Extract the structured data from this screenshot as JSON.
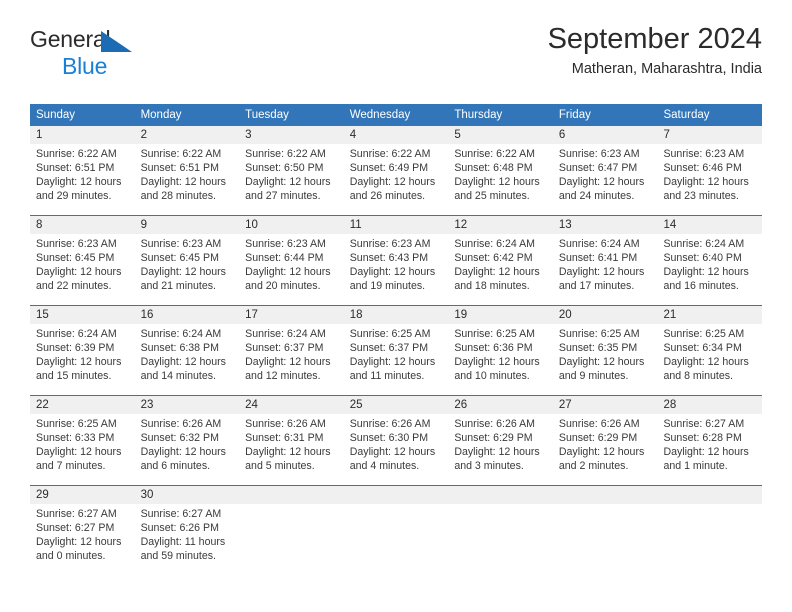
{
  "brand": {
    "name_part1": "General",
    "name_part2": "Blue",
    "triangle_color": "#1b6cb5",
    "blue_text_color": "#1b80d4"
  },
  "header": {
    "title": "September 2024",
    "subtitle": "Matheran, Maharashtra, India"
  },
  "theme": {
    "header_blue": "#3275b8",
    "day_band_gray": "#f0f0f0",
    "text_color": "#2b2b2b"
  },
  "weekdays": [
    "Sunday",
    "Monday",
    "Tuesday",
    "Wednesday",
    "Thursday",
    "Friday",
    "Saturday"
  ],
  "weeks": [
    {
      "days": [
        {
          "num": "1",
          "sunrise": "Sunrise: 6:22 AM",
          "sunset": "Sunset: 6:51 PM",
          "daylight1": "Daylight: 12 hours",
          "daylight2": "and 29 minutes."
        },
        {
          "num": "2",
          "sunrise": "Sunrise: 6:22 AM",
          "sunset": "Sunset: 6:51 PM",
          "daylight1": "Daylight: 12 hours",
          "daylight2": "and 28 minutes."
        },
        {
          "num": "3",
          "sunrise": "Sunrise: 6:22 AM",
          "sunset": "Sunset: 6:50 PM",
          "daylight1": "Daylight: 12 hours",
          "daylight2": "and 27 minutes."
        },
        {
          "num": "4",
          "sunrise": "Sunrise: 6:22 AM",
          "sunset": "Sunset: 6:49 PM",
          "daylight1": "Daylight: 12 hours",
          "daylight2": "and 26 minutes."
        },
        {
          "num": "5",
          "sunrise": "Sunrise: 6:22 AM",
          "sunset": "Sunset: 6:48 PM",
          "daylight1": "Daylight: 12 hours",
          "daylight2": "and 25 minutes."
        },
        {
          "num": "6",
          "sunrise": "Sunrise: 6:23 AM",
          "sunset": "Sunset: 6:47 PM",
          "daylight1": "Daylight: 12 hours",
          "daylight2": "and 24 minutes."
        },
        {
          "num": "7",
          "sunrise": "Sunrise: 6:23 AM",
          "sunset": "Sunset: 6:46 PM",
          "daylight1": "Daylight: 12 hours",
          "daylight2": "and 23 minutes."
        }
      ]
    },
    {
      "days": [
        {
          "num": "8",
          "sunrise": "Sunrise: 6:23 AM",
          "sunset": "Sunset: 6:45 PM",
          "daylight1": "Daylight: 12 hours",
          "daylight2": "and 22 minutes."
        },
        {
          "num": "9",
          "sunrise": "Sunrise: 6:23 AM",
          "sunset": "Sunset: 6:45 PM",
          "daylight1": "Daylight: 12 hours",
          "daylight2": "and 21 minutes."
        },
        {
          "num": "10",
          "sunrise": "Sunrise: 6:23 AM",
          "sunset": "Sunset: 6:44 PM",
          "daylight1": "Daylight: 12 hours",
          "daylight2": "and 20 minutes."
        },
        {
          "num": "11",
          "sunrise": "Sunrise: 6:23 AM",
          "sunset": "Sunset: 6:43 PM",
          "daylight1": "Daylight: 12 hours",
          "daylight2": "and 19 minutes."
        },
        {
          "num": "12",
          "sunrise": "Sunrise: 6:24 AM",
          "sunset": "Sunset: 6:42 PM",
          "daylight1": "Daylight: 12 hours",
          "daylight2": "and 18 minutes."
        },
        {
          "num": "13",
          "sunrise": "Sunrise: 6:24 AM",
          "sunset": "Sunset: 6:41 PM",
          "daylight1": "Daylight: 12 hours",
          "daylight2": "and 17 minutes."
        },
        {
          "num": "14",
          "sunrise": "Sunrise: 6:24 AM",
          "sunset": "Sunset: 6:40 PM",
          "daylight1": "Daylight: 12 hours",
          "daylight2": "and 16 minutes."
        }
      ]
    },
    {
      "days": [
        {
          "num": "15",
          "sunrise": "Sunrise: 6:24 AM",
          "sunset": "Sunset: 6:39 PM",
          "daylight1": "Daylight: 12 hours",
          "daylight2": "and 15 minutes."
        },
        {
          "num": "16",
          "sunrise": "Sunrise: 6:24 AM",
          "sunset": "Sunset: 6:38 PM",
          "daylight1": "Daylight: 12 hours",
          "daylight2": "and 14 minutes."
        },
        {
          "num": "17",
          "sunrise": "Sunrise: 6:24 AM",
          "sunset": "Sunset: 6:37 PM",
          "daylight1": "Daylight: 12 hours",
          "daylight2": "and 12 minutes."
        },
        {
          "num": "18",
          "sunrise": "Sunrise: 6:25 AM",
          "sunset": "Sunset: 6:37 PM",
          "daylight1": "Daylight: 12 hours",
          "daylight2": "and 11 minutes."
        },
        {
          "num": "19",
          "sunrise": "Sunrise: 6:25 AM",
          "sunset": "Sunset: 6:36 PM",
          "daylight1": "Daylight: 12 hours",
          "daylight2": "and 10 minutes."
        },
        {
          "num": "20",
          "sunrise": "Sunrise: 6:25 AM",
          "sunset": "Sunset: 6:35 PM",
          "daylight1": "Daylight: 12 hours",
          "daylight2": "and 9 minutes."
        },
        {
          "num": "21",
          "sunrise": "Sunrise: 6:25 AM",
          "sunset": "Sunset: 6:34 PM",
          "daylight1": "Daylight: 12 hours",
          "daylight2": "and 8 minutes."
        }
      ]
    },
    {
      "days": [
        {
          "num": "22",
          "sunrise": "Sunrise: 6:25 AM",
          "sunset": "Sunset: 6:33 PM",
          "daylight1": "Daylight: 12 hours",
          "daylight2": "and 7 minutes."
        },
        {
          "num": "23",
          "sunrise": "Sunrise: 6:26 AM",
          "sunset": "Sunset: 6:32 PM",
          "daylight1": "Daylight: 12 hours",
          "daylight2": "and 6 minutes."
        },
        {
          "num": "24",
          "sunrise": "Sunrise: 6:26 AM",
          "sunset": "Sunset: 6:31 PM",
          "daylight1": "Daylight: 12 hours",
          "daylight2": "and 5 minutes."
        },
        {
          "num": "25",
          "sunrise": "Sunrise: 6:26 AM",
          "sunset": "Sunset: 6:30 PM",
          "daylight1": "Daylight: 12 hours",
          "daylight2": "and 4 minutes."
        },
        {
          "num": "26",
          "sunrise": "Sunrise: 6:26 AM",
          "sunset": "Sunset: 6:29 PM",
          "daylight1": "Daylight: 12 hours",
          "daylight2": "and 3 minutes."
        },
        {
          "num": "27",
          "sunrise": "Sunrise: 6:26 AM",
          "sunset": "Sunset: 6:29 PM",
          "daylight1": "Daylight: 12 hours",
          "daylight2": "and 2 minutes."
        },
        {
          "num": "28",
          "sunrise": "Sunrise: 6:27 AM",
          "sunset": "Sunset: 6:28 PM",
          "daylight1": "Daylight: 12 hours",
          "daylight2": "and 1 minute."
        }
      ]
    },
    {
      "days": [
        {
          "num": "29",
          "sunrise": "Sunrise: 6:27 AM",
          "sunset": "Sunset: 6:27 PM",
          "daylight1": "Daylight: 12 hours",
          "daylight2": "and 0 minutes."
        },
        {
          "num": "30",
          "sunrise": "Sunrise: 6:27 AM",
          "sunset": "Sunset: 6:26 PM",
          "daylight1": "Daylight: 11 hours",
          "daylight2": "and 59 minutes."
        },
        {
          "num": "",
          "sunrise": "",
          "sunset": "",
          "daylight1": "",
          "daylight2": ""
        },
        {
          "num": "",
          "sunrise": "",
          "sunset": "",
          "daylight1": "",
          "daylight2": ""
        },
        {
          "num": "",
          "sunrise": "",
          "sunset": "",
          "daylight1": "",
          "daylight2": ""
        },
        {
          "num": "",
          "sunrise": "",
          "sunset": "",
          "daylight1": "",
          "daylight2": ""
        },
        {
          "num": "",
          "sunrise": "",
          "sunset": "",
          "daylight1": "",
          "daylight2": ""
        }
      ]
    }
  ]
}
